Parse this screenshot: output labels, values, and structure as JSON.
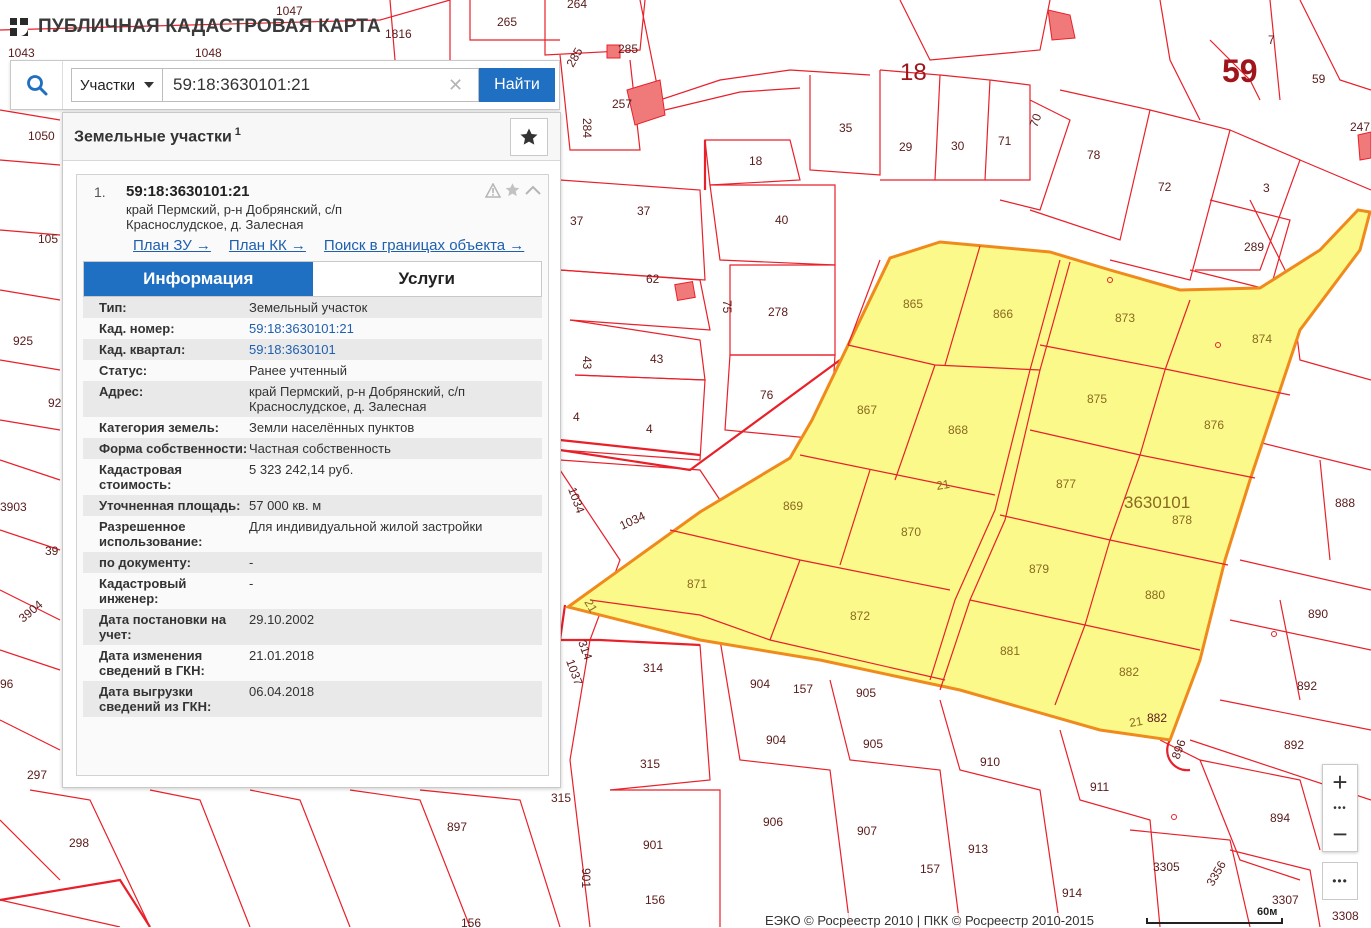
{
  "app": {
    "title": "ПУБЛИЧНАЯ КАДАСТРОВАЯ КАРТА"
  },
  "search": {
    "type_label": "Участки",
    "value": "59:18:3630101:21",
    "find_label": "Найти"
  },
  "panel": {
    "title": "Земельные участки",
    "count": "1"
  },
  "result": {
    "index": "1.",
    "cad_number": "59:18:3630101:21",
    "address": "край Пермский, р-н Добрянский, с/п Краснослудское, д. Залесная",
    "links": [
      "План ЗУ →",
      "План КК →",
      "Поиск в границах объекта →"
    ],
    "tabs": [
      "Информация",
      "Услуги"
    ],
    "info": [
      {
        "key": "Тип:",
        "value": "Земельный участок",
        "link": false
      },
      {
        "key": "Кад. номер:",
        "value": "59:18:3630101:21",
        "link": true
      },
      {
        "key": "Кад. квартал:",
        "value": "59:18:3630101",
        "link": true
      },
      {
        "key": "Статус:",
        "value": "Ранее учтенный",
        "link": false
      },
      {
        "key": "Адрес:",
        "value": "край Пермский, р-н Добрянский, с/п Краснослудское, д. Залесная",
        "link": false
      },
      {
        "key": "Категория земель:",
        "value": "Земли населённых пунктов",
        "link": false
      },
      {
        "key": "Форма собственности:",
        "value": "Частная собственность",
        "link": false
      },
      {
        "key": "Кадастровая стоимость:",
        "value": "5 323 242,14 руб.",
        "link": false
      },
      {
        "key": "Уточненная площадь:",
        "value": "57 000 кв. м",
        "link": false
      },
      {
        "key": "Разрешенное использование:",
        "value": "Для индивидуальной жилой застройки",
        "link": false
      },
      {
        "key": "по документу:",
        "value": "-",
        "link": false
      },
      {
        "key": "Кадастровый инженер:",
        "value": "-",
        "link": false
      },
      {
        "key": "Дата постановки на учет:",
        "value": "29.10.2002",
        "link": false
      },
      {
        "key": "Дата изменения сведений в ГКН:",
        "value": "21.01.2018",
        "link": false
      },
      {
        "key": "Дата выгрузки сведений из ГКН:",
        "value": "06.04.2018",
        "link": false
      }
    ]
  },
  "map": {
    "quarter_label": "3630101",
    "big_labels": [
      "18",
      "59"
    ],
    "parcel_labels": [
      "865",
      "866",
      "873",
      "874",
      "867",
      "868",
      "875",
      "876",
      "869",
      "870",
      "877",
      "878",
      "871",
      "872",
      "879",
      "880",
      "881",
      "882",
      "21",
      "21",
      "21"
    ],
    "other_labels": [
      "1047",
      "1816",
      "265",
      "264",
      "1043",
      "1048",
      "285",
      "285",
      "284",
      "257",
      "7",
      "59",
      "1050",
      "35",
      "29",
      "30",
      "71",
      "70",
      "78",
      "72",
      "3",
      "247",
      "18",
      "37",
      "37",
      "40",
      "289",
      "62",
      "75",
      "278",
      "105",
      "925",
      "43",
      "43",
      "92",
      "76",
      "4",
      "4",
      "1034",
      "1034",
      "3903",
      "39",
      "3904",
      "888",
      "96",
      "314",
      "314",
      "1037",
      "904",
      "157",
      "905",
      "890",
      "892",
      "892",
      "297",
      "904",
      "905",
      "910",
      "911",
      "894",
      "315",
      "315",
      "298",
      "897",
      "901",
      "901",
      "906",
      "907",
      "913",
      "157",
      "3305",
      "3356",
      "3307",
      "3308",
      "914",
      "156",
      "156",
      "882",
      "896"
    ],
    "parcel_fill": "#fbf98a",
    "boundary_color": "#e8202a",
    "highlight_color": "#f08a1c",
    "building_color": "#f07a7a"
  },
  "controls": {
    "zoom_in": "+",
    "zoom_dots": "•••",
    "zoom_out": "−",
    "more": "•••"
  },
  "footer": {
    "attribution": "ЕЭКО © Росреестр 2010 | ПКК © Росреестр 2010-2015",
    "scale": "60м"
  }
}
